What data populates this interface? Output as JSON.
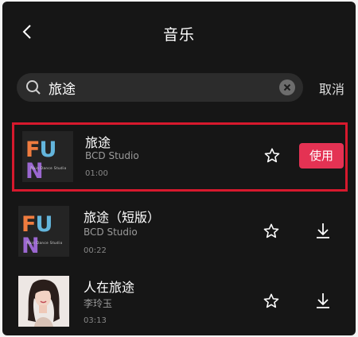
{
  "header": {
    "title": "音乐",
    "back_icon": "chevron-left-icon"
  },
  "search": {
    "value": "旅途",
    "placeholder": "",
    "cancel_label": "取消"
  },
  "colors": {
    "background": "#161616",
    "accent": "#e43253",
    "highlight_border": "#d7192d"
  },
  "songs": [
    {
      "title": "旅途",
      "artist": "BCD Studio",
      "duration": "01:00",
      "cover": "FUN",
      "selected": true,
      "action_label": "使用"
    },
    {
      "title": "旅途（短版）",
      "artist": "BCD Studio",
      "duration": "00:22",
      "cover": "FUN",
      "selected": false
    },
    {
      "title": "人在旅途",
      "artist": "李玲玉",
      "duration": "03:13",
      "cover": "portrait",
      "selected": false
    }
  ]
}
